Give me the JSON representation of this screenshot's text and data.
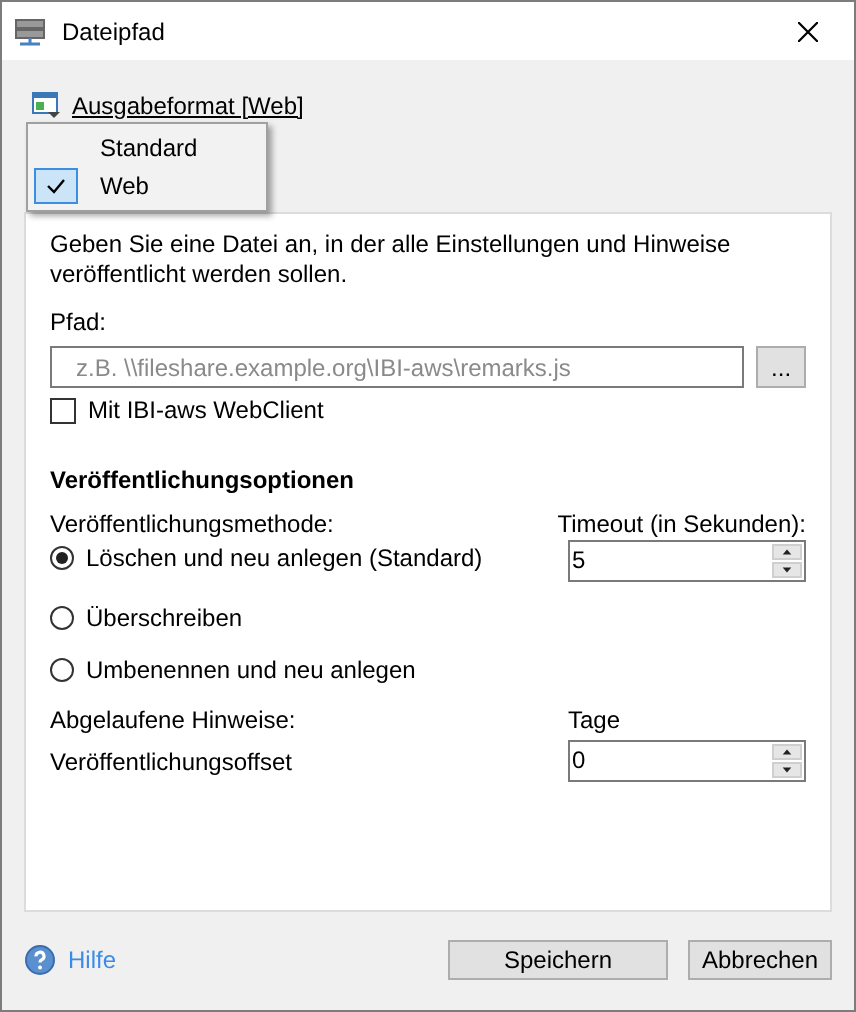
{
  "window": {
    "title": "Dateipfad"
  },
  "format_link": "Ausgabeformat [Web]",
  "format_menu": [
    {
      "label": "Standard",
      "selected": false
    },
    {
      "label": "Web",
      "selected": true
    }
  ],
  "description": "Geben Sie eine Datei an, in der alle Einstellungen und Hinweise veröffentlicht werden sollen.",
  "path": {
    "label": "Pfad:",
    "placeholder": "z.B. \\\\fileshare.example.org\\IBI-aws\\remarks.js",
    "browse": "..."
  },
  "webclient": {
    "label": "Mit IBI-aws WebClient",
    "checked": false
  },
  "options": {
    "heading": "Veröffentlichungsoptionen",
    "method_label": "Veröffentlichungsmethode:",
    "methods": [
      {
        "label": "Löschen und neu anlegen (Standard)",
        "selected": true
      },
      {
        "label": "Überschreiben",
        "selected": false
      },
      {
        "label": "Umbenennen und neu anlegen",
        "selected": false
      }
    ],
    "timeout": {
      "label": "Timeout (in Sekunden):",
      "value": "5"
    },
    "expired_label": "Abgelaufene Hinweise:",
    "days_label": "Tage",
    "offset": {
      "label": "Veröffentlichungsoffset",
      "value": "0"
    }
  },
  "footer": {
    "help": "Hilfe",
    "buttons": [
      "Speichern",
      "Abbrechen"
    ]
  }
}
